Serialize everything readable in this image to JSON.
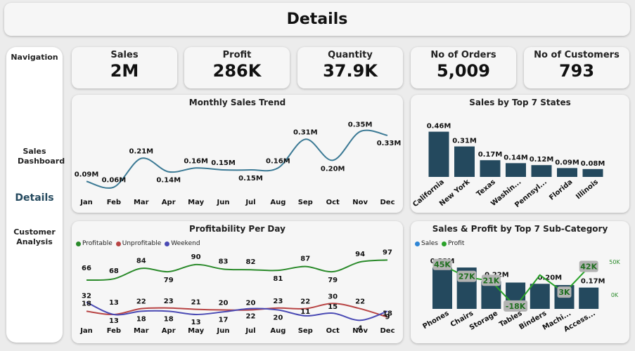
{
  "header": {
    "title": "Details"
  },
  "navigation": {
    "title": "Navigation",
    "items": [
      {
        "label": "Sales Dashboard",
        "active": false
      },
      {
        "label": "Details",
        "active": true
      },
      {
        "label": "Customer Analysis",
        "active": false
      }
    ]
  },
  "kpis": [
    {
      "label": "Sales",
      "value": "2M"
    },
    {
      "label": "Profit",
      "value": "286K"
    },
    {
      "label": "Quantity",
      "value": "37.9K"
    },
    {
      "label": "No of Orders",
      "value": "5,009"
    },
    {
      "label": "No of Customers",
      "value": "793"
    }
  ],
  "colors": {
    "line_teal": "#3c7a95",
    "bar": "#24495e",
    "profitable": "#2a8a2a",
    "unprofitable": "#b84444",
    "weekend": "#4a4ab4",
    "sales_legend": "#2f86d6",
    "profit_legend": "#2aa22a"
  },
  "chart_data": [
    {
      "type": "line",
      "title": "Monthly Sales Trend",
      "categories": [
        "Jan",
        "Feb",
        "Mar",
        "Apr",
        "May",
        "Jun",
        "Jul",
        "Aug",
        "Sep",
        "Oct",
        "Nov",
        "Dec"
      ],
      "values": [
        0.09,
        0.06,
        0.21,
        0.14,
        0.16,
        0.15,
        0.15,
        0.16,
        0.31,
        0.2,
        0.35,
        0.33
      ],
      "labels": [
        "0.09M",
        "0.06M",
        "0.21M",
        "0.14M",
        "0.16M",
        "0.15M",
        "0.15M",
        "0.16M",
        "0.31M",
        "0.20M",
        "0.35M",
        "0.33M"
      ],
      "ylim": [
        0.04,
        0.37
      ]
    },
    {
      "type": "bar",
      "title": "Sales by Top 7 States",
      "categories": [
        "California",
        "New York",
        "Texas",
        "Washin...",
        "Pennsyl...",
        "Florida",
        "Illinois"
      ],
      "values": [
        0.46,
        0.31,
        0.17,
        0.14,
        0.12,
        0.09,
        0.08
      ],
      "labels": [
        "0.46M",
        "0.31M",
        "0.17M",
        "0.14M",
        "0.12M",
        "0.09M",
        "0.08M"
      ],
      "ylim": [
        0,
        0.5
      ]
    },
    {
      "type": "line",
      "title": "Profitability Per Day",
      "categories": [
        "Jan",
        "Feb",
        "Mar",
        "Apr",
        "May",
        "Jun",
        "Jul",
        "Aug",
        "Sep",
        "Oct",
        "Nov",
        "Dec"
      ],
      "series": [
        {
          "name": "Profitable",
          "values": [
            66,
            68,
            84,
            79,
            90,
            83,
            82,
            81,
            87,
            79,
            94,
            97
          ]
        },
        {
          "name": "Unprofitable",
          "values": [
            18,
            13,
            22,
            23,
            21,
            20,
            20,
            23,
            22,
            30,
            22,
            9
          ]
        },
        {
          "name": "Weekend",
          "values": [
            32,
            13,
            18,
            18,
            13,
            17,
            22,
            20,
            11,
            15,
            4,
            18
          ]
        }
      ]
    },
    {
      "type": "bar",
      "title": "Sales & Profit by Top 7 Sub-Category",
      "legend": [
        "Sales",
        "Profit"
      ],
      "categories": [
        "Phones",
        "Chairs",
        "Storage",
        "Tables",
        "Binders",
        "Machi...",
        "Access..."
      ],
      "series": [
        {
          "name": "Sales",
          "values": [
            0.33,
            0.33,
            0.22,
            0.21,
            0.2,
            0.19,
            0.17
          ]
        },
        {
          "name": "Profit",
          "values": [
            45,
            27,
            21,
            -18,
            30,
            3,
            42
          ]
        }
      ],
      "sales_labels": [
        "0.33M",
        "",
        "0.22M",
        "",
        "0.20M",
        "",
        "0.17M"
      ],
      "profit_labels": [
        "45K",
        "27K",
        "21K",
        "-18K",
        "",
        "3K",
        "42K"
      ],
      "y2_ticks": [
        "50K",
        "0K"
      ]
    }
  ]
}
